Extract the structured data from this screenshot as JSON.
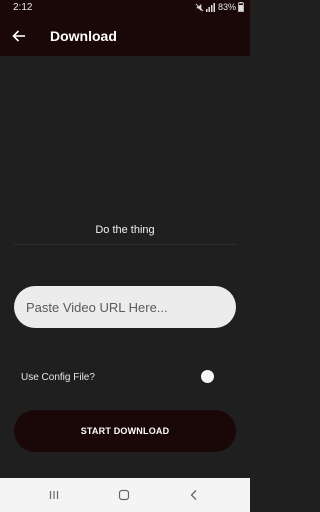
{
  "status_bar": {
    "time": "2:12",
    "battery": "83%",
    "icons": [
      "mute-icon",
      "signal-icon",
      "battery-icon"
    ]
  },
  "app_bar": {
    "title": "Download",
    "back_icon": "back-arrow-icon"
  },
  "main": {
    "headline": "Do the thing",
    "url_placeholder": "Paste Video URL Here...",
    "config_label": "Use Config File?",
    "config_enabled": false,
    "download_label": "START DOWNLOAD"
  },
  "nav_bar": {
    "icons": [
      "recent-apps-icon",
      "home-icon",
      "back-icon"
    ]
  },
  "colors": {
    "primary_dark": "#1a0708",
    "background": "#1f1f1f",
    "input_bg": "#ececec",
    "nav_bg": "#f4f4f4"
  }
}
